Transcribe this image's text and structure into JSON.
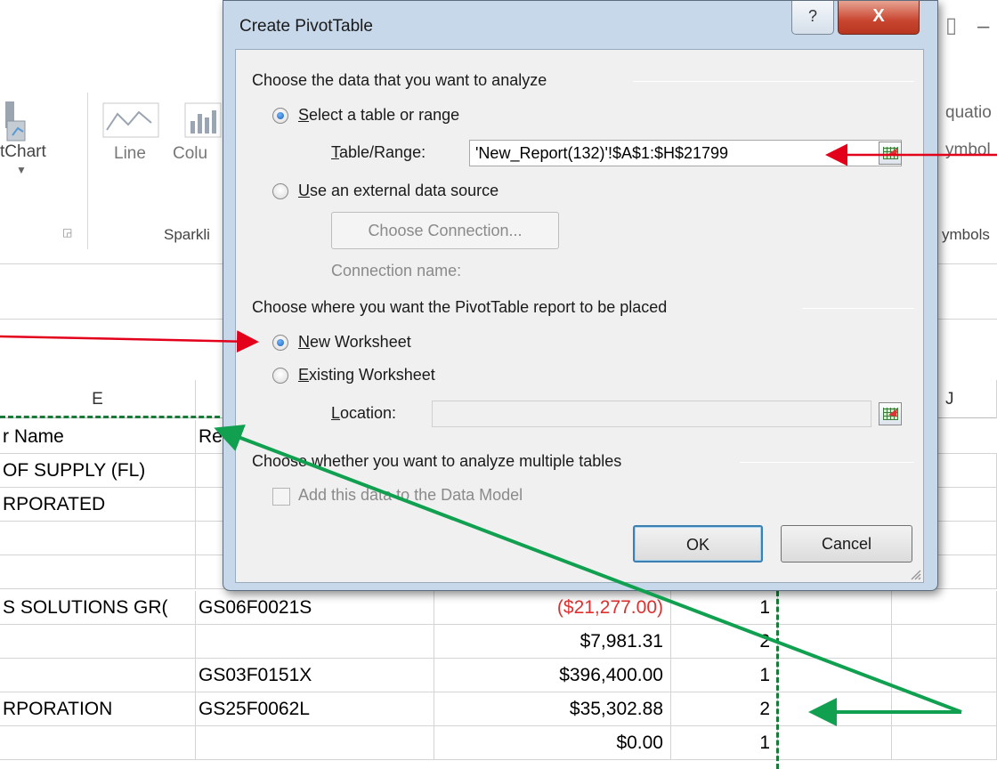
{
  "ribbon": {
    "chart_label": "tChart",
    "line_label": "Line",
    "column_label": "Colu",
    "sparklines_group": "Sparkli",
    "equation_label": "quatio",
    "symbol_label": "ymbol",
    "symbols_group": "ymbols",
    "window_controls": "– "
  },
  "columns": {
    "e": "E",
    "j": "J"
  },
  "grid": {
    "header_row": {
      "name": "r Name",
      "ref": "Re"
    },
    "rows": [
      {
        "name": "OF SUPPLY (FL)",
        "contract": "",
        "amount": "",
        "count": ""
      },
      {
        "name": "RPORATED",
        "contract": "",
        "amount": "",
        "count": ""
      },
      {
        "name": "",
        "contract": "",
        "amount": "",
        "count": ""
      },
      {
        "name": "",
        "contract": "",
        "amount": "",
        "count": ""
      },
      {
        "name": "S SOLUTIONS GR(",
        "contract": "GS06F0021S",
        "amount": "($21,277.00)",
        "count": "1"
      },
      {
        "name": "",
        "contract": "",
        "amount": "$7,981.31",
        "count": "2"
      },
      {
        "name": "",
        "contract": "GS03F0151X",
        "amount": "$396,400.00",
        "count": "1"
      },
      {
        "name": "RPORATION",
        "contract": "GS25F0062L",
        "amount": "$35,302.88",
        "count": "2"
      },
      {
        "name": "",
        "contract": "",
        "amount": "$0.00",
        "count": "1"
      }
    ]
  },
  "dialog": {
    "title": "Create PivotTable",
    "help_label": "?",
    "close_label": "X",
    "section1": "Choose the data that you want to analyze",
    "option_table_prefix": "S",
    "option_table_rest": "elect a table or range",
    "table_range_prefix": "T",
    "table_range_rest": "able/Range:",
    "table_range_value": "'New_Report(132)'!$A$1:$H$21799",
    "option_external_prefix": "U",
    "option_external_rest": "se an external data source",
    "choose_connection": "Choose Connection...",
    "connection_name": "Connection name:",
    "section2": "Choose where you want the PivotTable report to be placed",
    "option_new_prefix": "N",
    "option_new_rest": "ew Worksheet",
    "option_existing_prefix": "E",
    "option_existing_rest": "xisting Worksheet",
    "location_prefix": "L",
    "location_rest": "ocation:",
    "location_value": "",
    "section3": "Choose whether you want to analyze multiple tables",
    "add_data_model": "Add this data to the Data Model",
    "ok": "OK",
    "cancel": "Cancel"
  },
  "colors": {
    "red_arrow": "#e3001b",
    "green_arrow": "#10a050",
    "negative": "#e03030"
  }
}
